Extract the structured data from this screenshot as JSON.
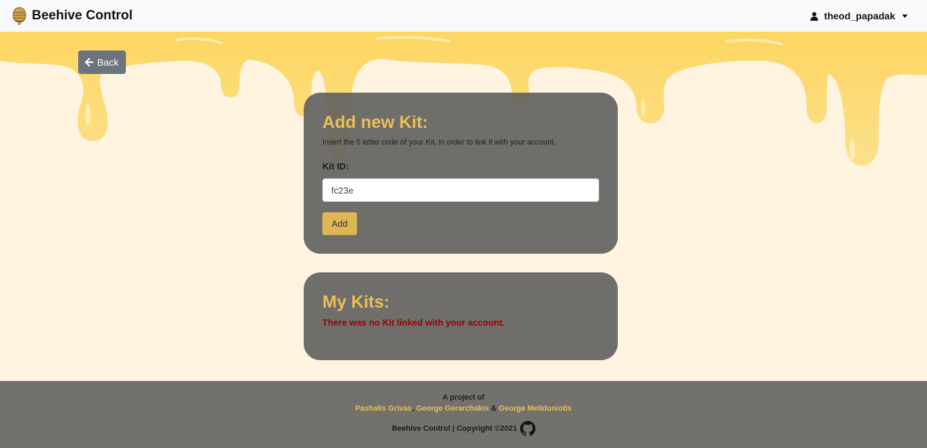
{
  "navbar": {
    "brand": "Beehive Control",
    "user": "theod_papadak"
  },
  "back": {
    "label": "Back"
  },
  "add_kit": {
    "title": "Add new Kit:",
    "subtitle": "Insert the 5 letter code of your Kit, in order to link it with your account.",
    "field_label": "Kit ID:",
    "field_value": "fc23e",
    "button": "Add"
  },
  "my_kits": {
    "title": "My Kits:",
    "empty_message": "There was no Kit linked with your account."
  },
  "footer": {
    "intro": "A project of",
    "authors": [
      "Pashalis Grivas",
      "George Gerarchakis",
      "George Melidoniotis"
    ],
    "sep_comma": ",",
    "sep_amp": "&",
    "copyright": "Beehive Control | Copyright ©2021"
  },
  "colors": {
    "accent": "#e9bf59",
    "card": "#646260",
    "error": "#9b0000",
    "background": "#fff4df",
    "honey": "#fcd862"
  },
  "icons": [
    "beehive-logo-icon",
    "user-icon",
    "caret-down-icon",
    "arrow-left-icon",
    "github-icon"
  ]
}
